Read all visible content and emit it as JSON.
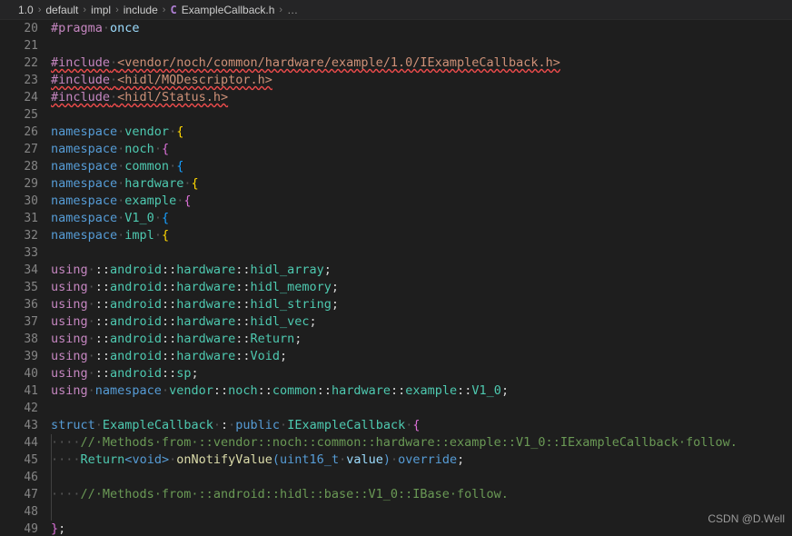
{
  "breadcrumb": {
    "separator": "›",
    "ellipsis": "…",
    "class_icon": "C",
    "items": [
      "1.0",
      "default",
      "impl",
      "include",
      "ExampleCallback.h"
    ]
  },
  "editor": {
    "theme_background": "#1e1e1e",
    "gutter_color": "#858585",
    "first_line_number": 20,
    "last_line_number": 49,
    "whitespace_marker": "·",
    "lines": [
      {
        "n": 20,
        "text": "#pragma·once"
      },
      {
        "n": 21,
        "text": ""
      },
      {
        "n": 22,
        "text": "#include·<vendor/noch/common/hardware/example/1.0/IExampleCallback.h>"
      },
      {
        "n": 23,
        "text": "#include·<hidl/MQDescriptor.h>"
      },
      {
        "n": 24,
        "text": "#include·<hidl/Status.h>"
      },
      {
        "n": 25,
        "text": ""
      },
      {
        "n": 26,
        "text": "namespace·vendor·{"
      },
      {
        "n": 27,
        "text": "namespace·noch·{"
      },
      {
        "n": 28,
        "text": "namespace·common·{"
      },
      {
        "n": 29,
        "text": "namespace·hardware·{"
      },
      {
        "n": 30,
        "text": "namespace·example·{"
      },
      {
        "n": 31,
        "text": "namespace·V1_0·{"
      },
      {
        "n": 32,
        "text": "namespace·impl·{"
      },
      {
        "n": 33,
        "text": ""
      },
      {
        "n": 34,
        "text": "using·::android::hardware::hidl_array;"
      },
      {
        "n": 35,
        "text": "using·::android::hardware::hidl_memory;"
      },
      {
        "n": 36,
        "text": "using·::android::hardware::hidl_string;"
      },
      {
        "n": 37,
        "text": "using·::android::hardware::hidl_vec;"
      },
      {
        "n": 38,
        "text": "using·::android::hardware::Return;"
      },
      {
        "n": 39,
        "text": "using·::android::hardware::Void;"
      },
      {
        "n": 40,
        "text": "using·::android::sp;"
      },
      {
        "n": 41,
        "text": "using·namespace·vendor::noch::common::hardware::example::V1_0;"
      },
      {
        "n": 42,
        "text": ""
      },
      {
        "n": 43,
        "text": "struct·ExampleCallback·:·public·IExampleCallback·{"
      },
      {
        "n": 44,
        "text": "····//·Methods·from·::vendor::noch::common::hardware::example::V1_0::IExampleCallback·follow."
      },
      {
        "n": 45,
        "text": "····Return<void>·onNotifyValue(uint16_t·value)·override;"
      },
      {
        "n": 46,
        "text": ""
      },
      {
        "n": 47,
        "text": "····//·Methods·from·::android::hidl::base::V1_0::IBase·follow."
      },
      {
        "n": 48,
        "text": ""
      },
      {
        "n": 49,
        "text": "};"
      }
    ]
  },
  "watermark": {
    "text": "CSDN @D.Well"
  }
}
